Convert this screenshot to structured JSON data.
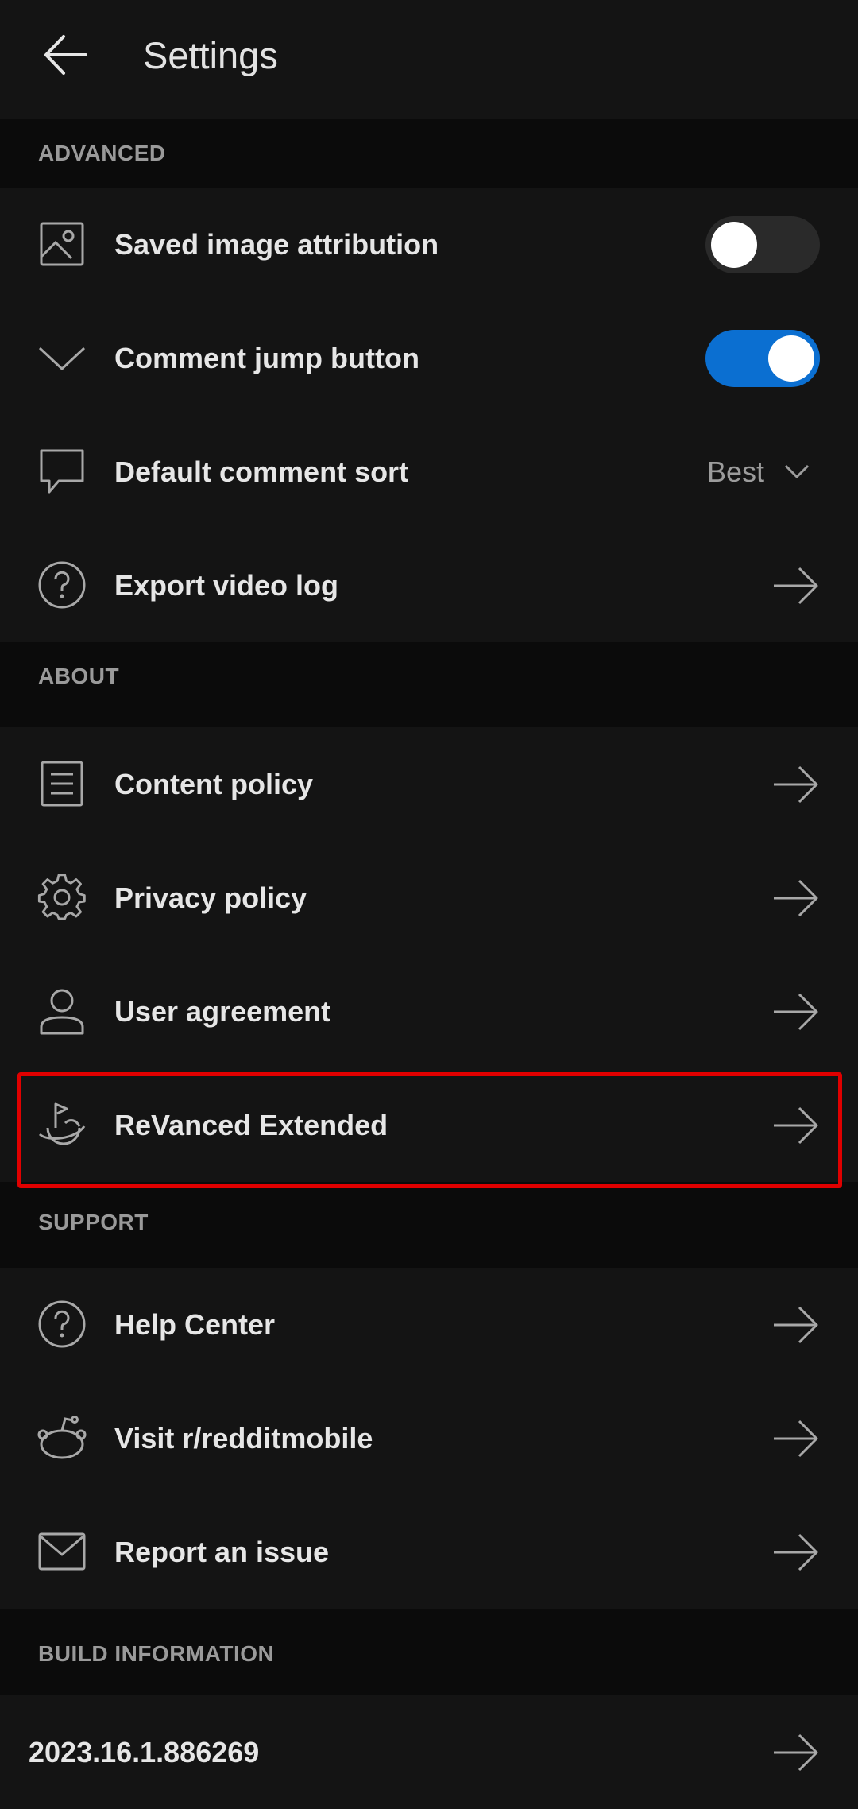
{
  "header": {
    "title": "Settings"
  },
  "sections": {
    "advanced": {
      "title": "ADVANCED",
      "items": [
        {
          "label": "Saved image attribution",
          "icon": "image-icon",
          "control": "toggle",
          "state": "off"
        },
        {
          "label": "Comment jump button",
          "icon": "chevron-down-icon",
          "control": "toggle",
          "state": "on"
        },
        {
          "label": "Default comment sort",
          "icon": "comment-icon",
          "control": "select",
          "value": "Best"
        },
        {
          "label": "Export video log",
          "icon": "help-circle-icon",
          "control": "arrow"
        }
      ]
    },
    "about": {
      "title": "ABOUT",
      "items": [
        {
          "label": "Content policy",
          "icon": "document-icon",
          "control": "arrow"
        },
        {
          "label": "Privacy policy",
          "icon": "gear-icon",
          "control": "arrow"
        },
        {
          "label": "User agreement",
          "icon": "user-icon",
          "control": "arrow"
        },
        {
          "label": "ReVanced Extended",
          "icon": "planet-flag-icon",
          "control": "arrow"
        }
      ]
    },
    "support": {
      "title": "SUPPORT",
      "items": [
        {
          "label": "Help Center",
          "icon": "help-circle-icon",
          "control": "arrow"
        },
        {
          "label": "Visit r/redditmobile",
          "icon": "reddit-alien-icon",
          "control": "arrow"
        },
        {
          "label": "Report an issue",
          "icon": "mail-icon",
          "control": "arrow"
        }
      ]
    },
    "build": {
      "title": "BUILD INFORMATION",
      "version": "2023.16.1.886269"
    }
  },
  "colors": {
    "background": "#0b0b0b",
    "surface": "#141414",
    "accent": "#0b6fd1",
    "highlight_border": "#e00000",
    "section_header_text": "#9a9a9a"
  }
}
